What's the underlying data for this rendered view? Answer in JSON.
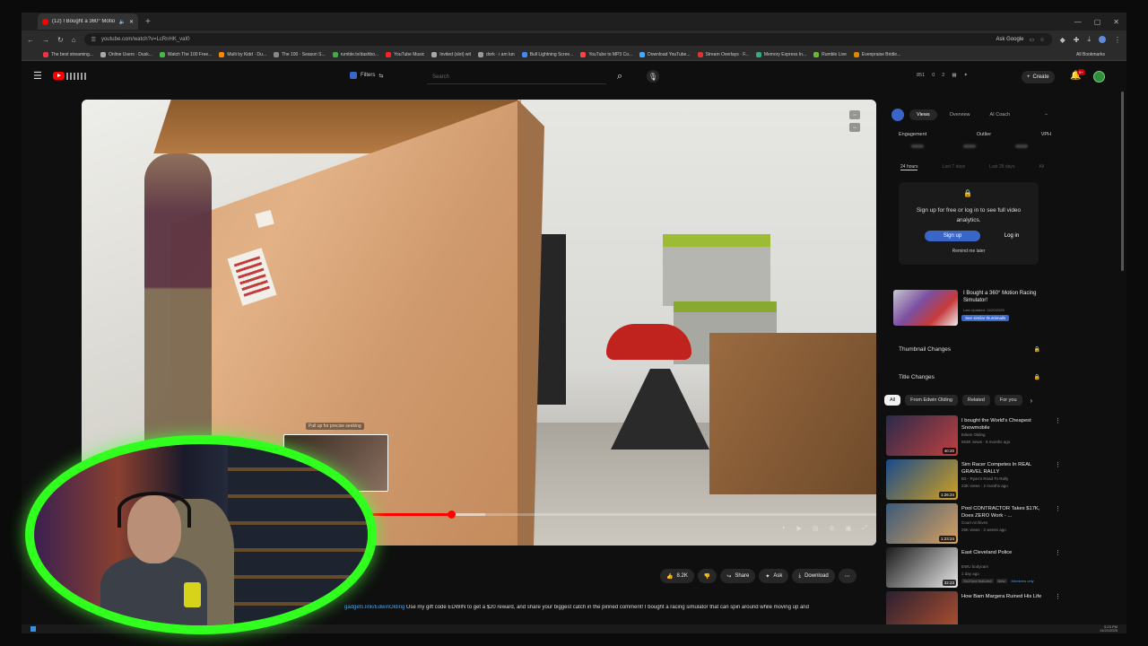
{
  "browser": {
    "tab_title": "(12) I Bought a 360° Motion...",
    "url": "youtube.com/watch?v=LcRnHK_vaI0",
    "ask_google": "Ask Google",
    "bookmarks": [
      "The best streaming...",
      "Online Users · Dusk...",
      "Watch The 100 Free...",
      "Multi by Kidd · Du...",
      "The 100 · Season S...",
      "rumble.tv/dashbo...",
      "YouTube Music",
      "Invited (slot) wit",
      "dork · i am lun",
      "Bull Lightning Scree...",
      "YouTube to MP3 Co...",
      "Download YouTube...",
      "Stream Overlays · F...",
      "Memory Express In...",
      "Rumble Live",
      "Evenpraise Bridle..."
    ],
    "all_bookmarks": "All Bookmarks"
  },
  "yt_header": {
    "filters_label": "Filters",
    "search_placeholder": "Search",
    "stats": [
      "851",
      "0",
      "2"
    ],
    "create_label": "Create",
    "notif_count": "9+"
  },
  "video": {
    "preview_label": "Pull up for precise seeking",
    "progress_played": 0.465,
    "progress_buffered": 0.508
  },
  "actions": {
    "likes": "8.2K",
    "share": "Share",
    "ask": "Ask",
    "download": "Download"
  },
  "description": {
    "link": "gadgets.link/EdwinOlding",
    "text": " Use my gift code EDWIN to get a $20 reward, and share your biggest catch in the pinned comment! I bought a racing simulator that can spin around while moving up and"
  },
  "panel": {
    "tabs": [
      "Views",
      "Overview",
      "AI Coach"
    ],
    "active_tab": "Views",
    "metrics": [
      "Engagement",
      "Outlier",
      "VPH"
    ],
    "ranges": [
      "24 hours",
      "Last 7 days",
      "Last 28 days",
      "All"
    ],
    "lock_message": "Sign up for free or log in to see full video analytics.",
    "signup": "Sign up",
    "login": "Log in",
    "remind": "Remind me later",
    "video_title": "I Bought a 360° Motion Racing Simulator!",
    "video_date": "Last Updated: 11/20/2025",
    "similar_btn": "See similar thumbnails",
    "thumb_changes": "Thumbnail Changes",
    "title_changes": "Title Changes"
  },
  "chips": [
    "All",
    "From Edwin Olding",
    "Related",
    "For you"
  ],
  "recommendations": [
    {
      "title": "I bought the World's Cheapest Snowmobile",
      "channel": "Edwin Olding",
      "meta": "553K views · 8 months ago",
      "duration": "40:20",
      "colors": [
        "#2a2a4a",
        "#c04040"
      ],
      "badges": []
    },
    {
      "title": "Sim Racer Competes In REAL GRAVEL RALLY",
      "channel": "B3 - Ryan's Road To Rally",
      "meta": "23K views · 2 months ago",
      "duration": "1:26:24",
      "colors": [
        "#1a4a8a",
        "#d0a020"
      ],
      "badges": []
    },
    {
      "title": "Pool CONTRACTOR Takes $17K, Does ZERO Work - ...",
      "channel": "Court Archives",
      "meta": "25K views · 2 weeks ago",
      "duration": "1:23:24",
      "colors": [
        "#3a5a7a",
        "#d8a060"
      ],
      "badges": []
    },
    {
      "title": "East Cleveland Police",
      "channel": "EWU bodycam",
      "meta": "1 day ago",
      "duration": "32:23",
      "colors": [
        "#1a1a1a",
        "#e8e8e8"
      ],
      "badges": [
        "YouTube featured",
        "New"
      ],
      "members": "Members only"
    },
    {
      "title": "How Bam Margera Ruined His Life",
      "channel": "",
      "meta": "",
      "duration": "",
      "colors": [
        "#2a2030",
        "#b05030"
      ],
      "badges": []
    }
  ],
  "taskbar": {
    "time": "5:23 PM",
    "date": "11/21/2025"
  }
}
